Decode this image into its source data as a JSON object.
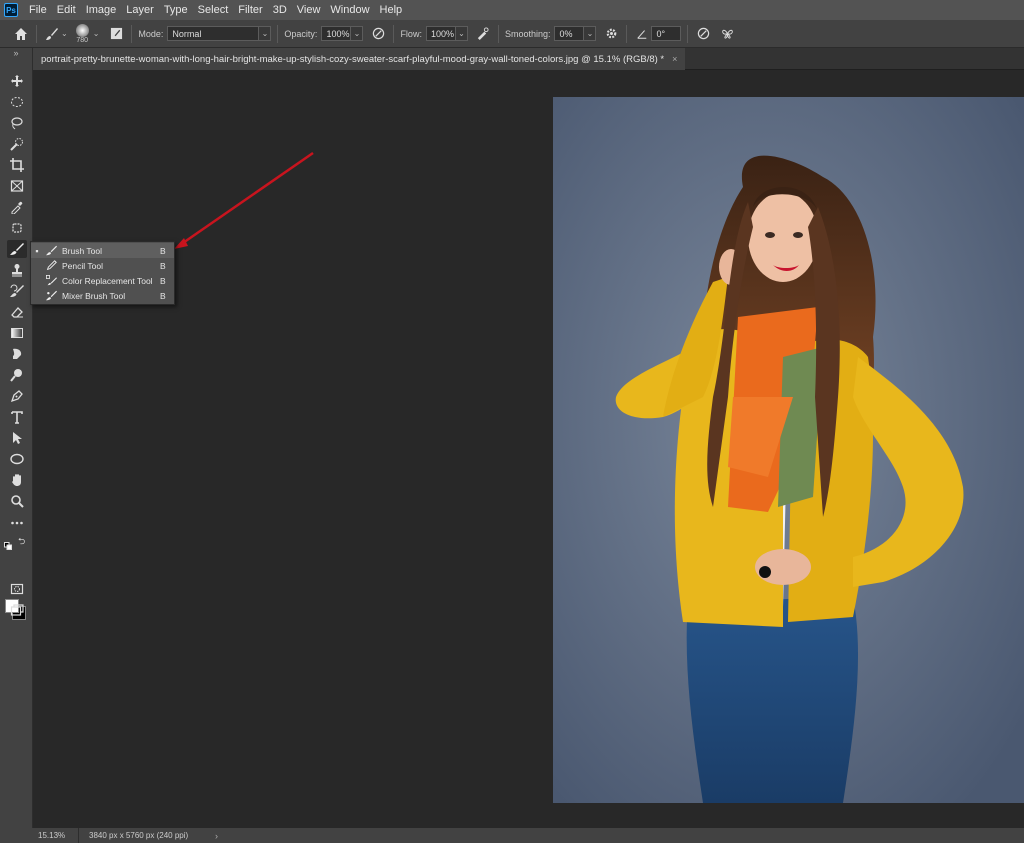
{
  "menubar": {
    "logo": "Ps",
    "items": [
      "File",
      "Edit",
      "Image",
      "Layer",
      "Type",
      "Select",
      "Filter",
      "3D",
      "View",
      "Window",
      "Help"
    ]
  },
  "options": {
    "brush_size": "780",
    "mode_label": "Mode:",
    "mode_value": "Normal",
    "opacity_label": "Opacity:",
    "opacity_value": "100%",
    "flow_label": "Flow:",
    "flow_value": "100%",
    "smoothing_label": "Smoothing:",
    "smoothing_value": "0%",
    "angle_value": "0°"
  },
  "document": {
    "tab_title": "portrait-pretty-brunette-woman-with-long-hair-bright-make-up-stylish-cozy-sweater-scarf-playful-mood-gray-wall-toned-colors.jpg @ 15.1% (RGB/8) *",
    "close": "×"
  },
  "flyout": {
    "items": [
      {
        "label": "Brush Tool",
        "key": "B",
        "selected": true
      },
      {
        "label": "Pencil Tool",
        "key": "B",
        "selected": false
      },
      {
        "label": "Color Replacement Tool",
        "key": "B",
        "selected": false
      },
      {
        "label": "Mixer Brush Tool",
        "key": "B",
        "selected": false
      }
    ]
  },
  "status": {
    "zoom": "15.13%",
    "doc_info": "3840 px x 5760 px (240 ppi)",
    "arrow": "›"
  },
  "toolbar": {
    "grip": "»"
  },
  "colors": {
    "annotation_arrow": "#c8141e",
    "foreground": "#ffffff",
    "background": "#000000"
  }
}
